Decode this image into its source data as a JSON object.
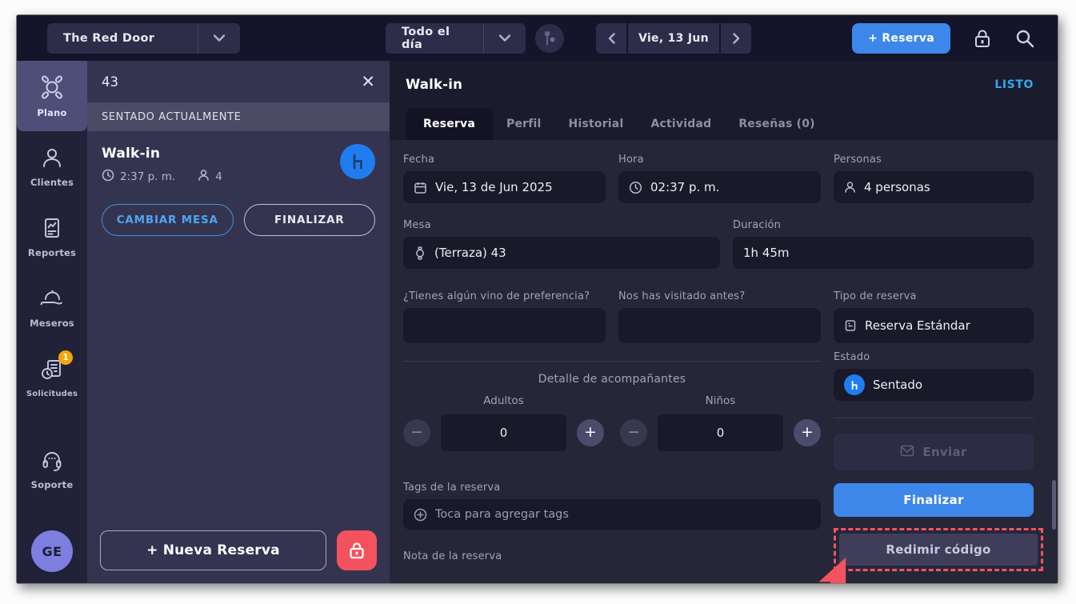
{
  "colors": {
    "accent_blue": "#3d87ea",
    "status_ready": "#2fa9f0",
    "seated_blue": "#1f7df0",
    "danger_red": "#f4525e",
    "badge_orange": "#f5a40b",
    "avatar_purple": "#7e7ee1"
  },
  "icons": {
    "close": "✕",
    "minus": "−",
    "plus": "+"
  },
  "topbar": {
    "venue": "The Red Door",
    "shift": "Todo el día",
    "date": "Vie, 13 Jun",
    "new_reservation_label": "+ Reserva"
  },
  "sidebar": {
    "items": [
      {
        "label": "Plano",
        "icon": "floor-plan-icon",
        "active": true
      },
      {
        "label": "Clientes",
        "icon": "person-icon"
      },
      {
        "label": "Reportes",
        "icon": "report-icon"
      },
      {
        "label": "Meseros",
        "icon": "waiter-cloche-icon"
      },
      {
        "label": "Solicitudes",
        "icon": "requests-icon",
        "badge": "1"
      },
      {
        "label": "Soporte",
        "icon": "headset-icon"
      }
    ],
    "avatar_initials": "GE"
  },
  "list_panel": {
    "search_value": "43",
    "section_header": "SENTADO ACTUALMENTE",
    "card": {
      "title": "Walk-in",
      "time": "2:37 p. m.",
      "guests": "4",
      "change_table_label": "CAMBIAR MESA",
      "finish_label": "FINALIZAR"
    },
    "new_reservation_label": "+ Nueva Reserva"
  },
  "detail": {
    "title": "Walk-in",
    "status": "LISTO",
    "tabs": [
      {
        "label": "Reserva",
        "active": true
      },
      {
        "label": "Perfil"
      },
      {
        "label": "Historial"
      },
      {
        "label": "Actividad"
      },
      {
        "label": "Reseñas (0)"
      }
    ],
    "fields": {
      "fecha": {
        "label": "Fecha",
        "value": "Vie, 13 de Jun 2025"
      },
      "hora": {
        "label": "Hora",
        "value": "02:37 p. m."
      },
      "personas": {
        "label": "Personas",
        "value": "4 personas"
      },
      "mesa": {
        "label": "Mesa",
        "value": "(Terraza) 43"
      },
      "duracion": {
        "label": "Duración",
        "value": "1h 45m"
      },
      "vino": {
        "label": "¿Tienes algún vino de preferencia?",
        "value": ""
      },
      "visitado": {
        "label": "Nos has visitado antes?",
        "value": ""
      },
      "tipo": {
        "label": "Tipo de reserva",
        "value": "Reserva Estándar"
      },
      "estado": {
        "label": "Estado",
        "value": "Sentado"
      }
    },
    "companions": {
      "title": "Detalle de acompañantes",
      "adults_label": "Adultos",
      "adults_value": "0",
      "children_label": "Niños",
      "children_value": "0"
    },
    "actions": {
      "send_label": "Enviar",
      "finalize_label": "Finalizar",
      "redeem_label": "Redimir código"
    },
    "tags": {
      "label": "Tags de la reserva",
      "placeholder": "Toca para agregar tags"
    },
    "note": {
      "label": "Nota de la reserva"
    }
  }
}
